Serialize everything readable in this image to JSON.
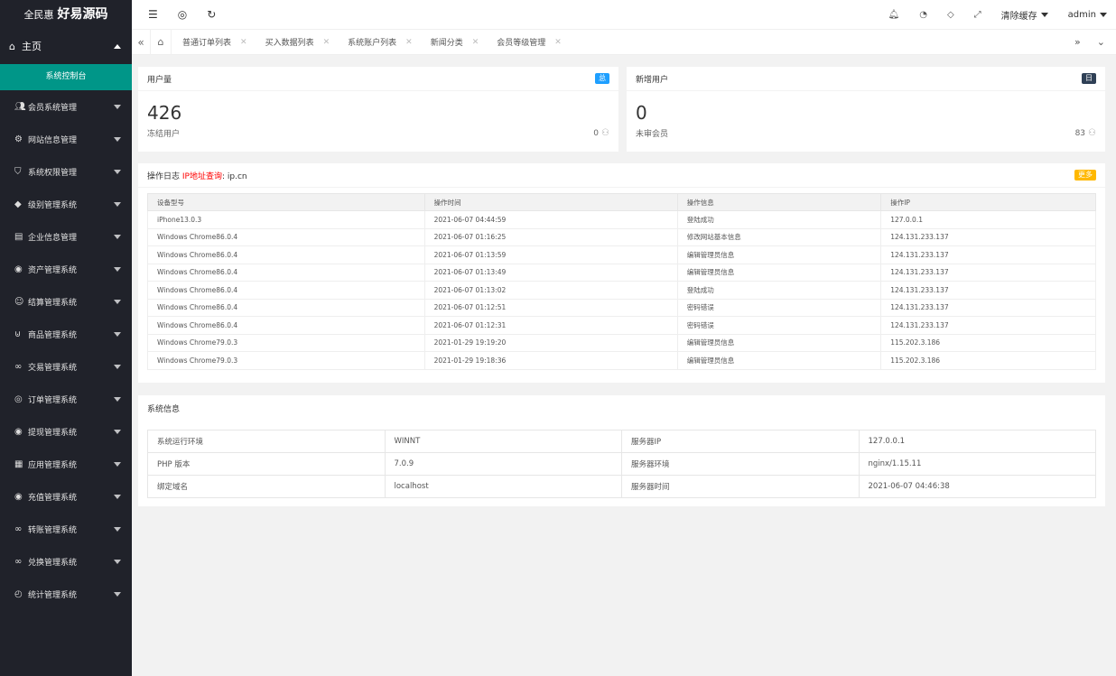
{
  "app": {
    "brand_small": "全民惠",
    "brand_big": "好易源码"
  },
  "sidebar": {
    "home": "主页",
    "home_sub": "系统控制台",
    "items": [
      {
        "label": "会员系统管理",
        "icon": "users-icon"
      },
      {
        "label": "网站信息管理",
        "icon": "gear-icon"
      },
      {
        "label": "系统权限管理",
        "icon": "shield-icon"
      },
      {
        "label": "级别管理系统",
        "icon": "diamond-icon"
      },
      {
        "label": "企业信息管理",
        "icon": "document-icon"
      },
      {
        "label": "资产管理系统",
        "icon": "coin-icon"
      },
      {
        "label": "结算管理系统",
        "icon": "smile-icon"
      },
      {
        "label": "商品管理系统",
        "icon": "cart-icon"
      },
      {
        "label": "交易管理系统",
        "icon": "link-icon"
      },
      {
        "label": "订单管理系统",
        "icon": "location-icon"
      },
      {
        "label": "提现管理系统",
        "icon": "coin-icon"
      },
      {
        "label": "应用管理系统",
        "icon": "apps-icon"
      },
      {
        "label": "充值管理系统",
        "icon": "coin-icon"
      },
      {
        "label": "转账管理系统",
        "icon": "link-icon"
      },
      {
        "label": "兑换管理系统",
        "icon": "link-icon"
      },
      {
        "label": "统计管理系统",
        "icon": "chart-icon"
      }
    ]
  },
  "header": {
    "clear_cache": "清除缓存",
    "user": "admin"
  },
  "tabs": [
    "普通订单列表",
    "买入数据列表",
    "系统账户列表",
    "新闻分类",
    "会员等级管理"
  ],
  "user_card": {
    "title": "用户量",
    "badge": "总",
    "value": "426",
    "foot_label": "冻结用户",
    "foot_value": "0"
  },
  "new_user_card": {
    "title": "新增用户",
    "badge": "日",
    "value": "0",
    "foot_label": "未审会员",
    "foot_value": "83"
  },
  "log_card": {
    "title_prefix": "操作日志",
    "title_link": "IP地址查询",
    "title_suffix": "ip.cn",
    "badge": "更多",
    "columns": [
      "设备型号",
      "操作时间",
      "操作信息",
      "操作IP"
    ],
    "rows": [
      [
        "iPhone13.0.3",
        "2021-06-07 04:44:59",
        "登陆成功",
        "127.0.0.1"
      ],
      [
        "Windows Chrome86.0.4",
        "2021-06-07 01:16:25",
        "修改网站基本信息",
        "124.131.233.137"
      ],
      [
        "Windows Chrome86.0.4",
        "2021-06-07 01:13:59",
        "编辑管理员信息",
        "124.131.233.137"
      ],
      [
        "Windows Chrome86.0.4",
        "2021-06-07 01:13:49",
        "编辑管理员信息",
        "124.131.233.137"
      ],
      [
        "Windows Chrome86.0.4",
        "2021-06-07 01:13:02",
        "登陆成功",
        "124.131.233.137"
      ],
      [
        "Windows Chrome86.0.4",
        "2021-06-07 01:12:51",
        "密码错误",
        "124.131.233.137"
      ],
      [
        "Windows Chrome86.0.4",
        "2021-06-07 01:12:31",
        "密码错误",
        "124.131.233.137"
      ],
      [
        "Windows Chrome79.0.3",
        "2021-01-29 19:19:20",
        "编辑管理员信息",
        "115.202.3.186"
      ],
      [
        "Windows Chrome79.0.3",
        "2021-01-29 19:18:36",
        "编辑管理员信息",
        "115.202.3.186"
      ]
    ]
  },
  "sys_card": {
    "title": "系统信息",
    "rows": [
      [
        "系统运行环境",
        "WINNT",
        "服务器IP",
        "127.0.0.1"
      ],
      [
        "PHP 版本",
        "7.0.9",
        "服务器环境",
        "nginx/1.15.11"
      ],
      [
        "绑定域名",
        "localhost",
        "服务器时间",
        "2021-06-07 04:46:38"
      ]
    ]
  },
  "colors": {
    "sidebar_bg": "#20222a",
    "active": "#009688",
    "link_red": "#ff0000"
  }
}
